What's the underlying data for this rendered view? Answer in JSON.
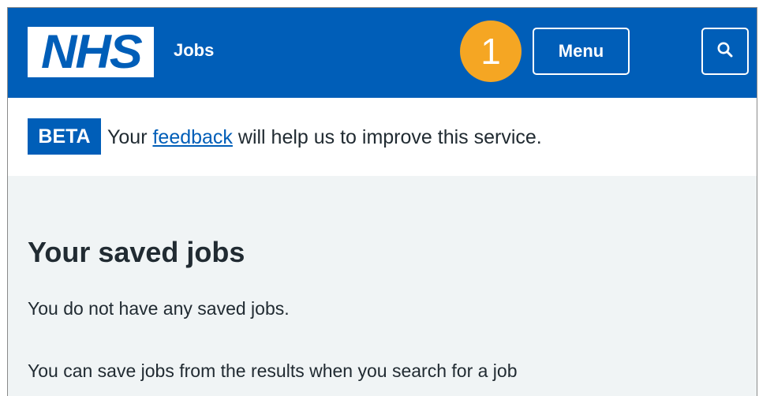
{
  "header": {
    "logo_text": "NHS",
    "service_name": "Jobs",
    "step_number": "1",
    "menu_label": "Menu",
    "search_icon": "search-icon",
    "background_color": "#005eb8"
  },
  "beta_banner": {
    "tag": "BETA",
    "text_before": "Your ",
    "link_text": "feedback",
    "text_after": " will help us to improve this service."
  },
  "main": {
    "title": "Your saved jobs",
    "paragraph_1": "You do not have any saved jobs.",
    "paragraph_2": "You can save jobs from the results when you search for a job"
  },
  "colors": {
    "nhs_blue": "#005eb8",
    "step_badge": "#f5a623",
    "page_background": "#f0f4f5",
    "text": "#212b32"
  }
}
